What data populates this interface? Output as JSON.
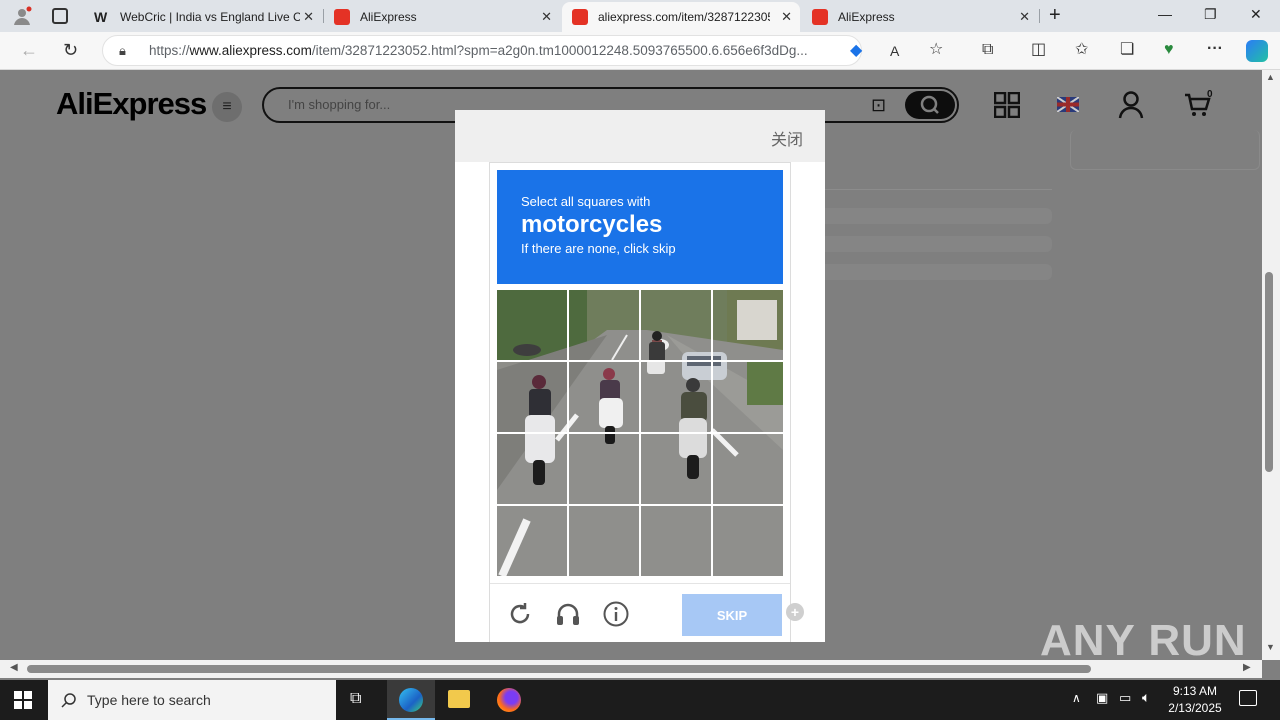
{
  "browser": {
    "tabs": [
      {
        "title": "WebCric | India vs England Live C",
        "favicon": "webcric-icon",
        "active": false
      },
      {
        "title": "AliExpress",
        "favicon": "aliexpress-icon",
        "active": false
      },
      {
        "title": "aliexpress.com/item/3287122305",
        "favicon": "aliexpress-icon",
        "active": true
      },
      {
        "title": "AliExpress",
        "favicon": "aliexpress-icon",
        "active": false
      }
    ],
    "url_prefix": "https://",
    "url_host": "www.aliexpress.com",
    "url_path": "/item/32871223052.html?spm=a2g0n.tm1000012248.5093765500.6.656e6f3dDg..."
  },
  "site": {
    "logo": "AliExpress",
    "search_placeholder": "I'm shopping for...",
    "cart_count": "0"
  },
  "modal": {
    "close_label": "关闭"
  },
  "captcha": {
    "instruction_line1": "Select all squares with",
    "target": "motorcycles",
    "instruction_line3": "If there are none, click skip",
    "skip_label": "SKIP"
  },
  "watermark": "ANY RUN",
  "taskbar": {
    "search_placeholder": "Type here to search",
    "time": "9:13 AM",
    "date": "2/13/2025"
  },
  "colors": {
    "captcha_banner": "#1a73e8",
    "skip_button": "#a7c8f5",
    "page_overlay": "#7f7f7f"
  }
}
